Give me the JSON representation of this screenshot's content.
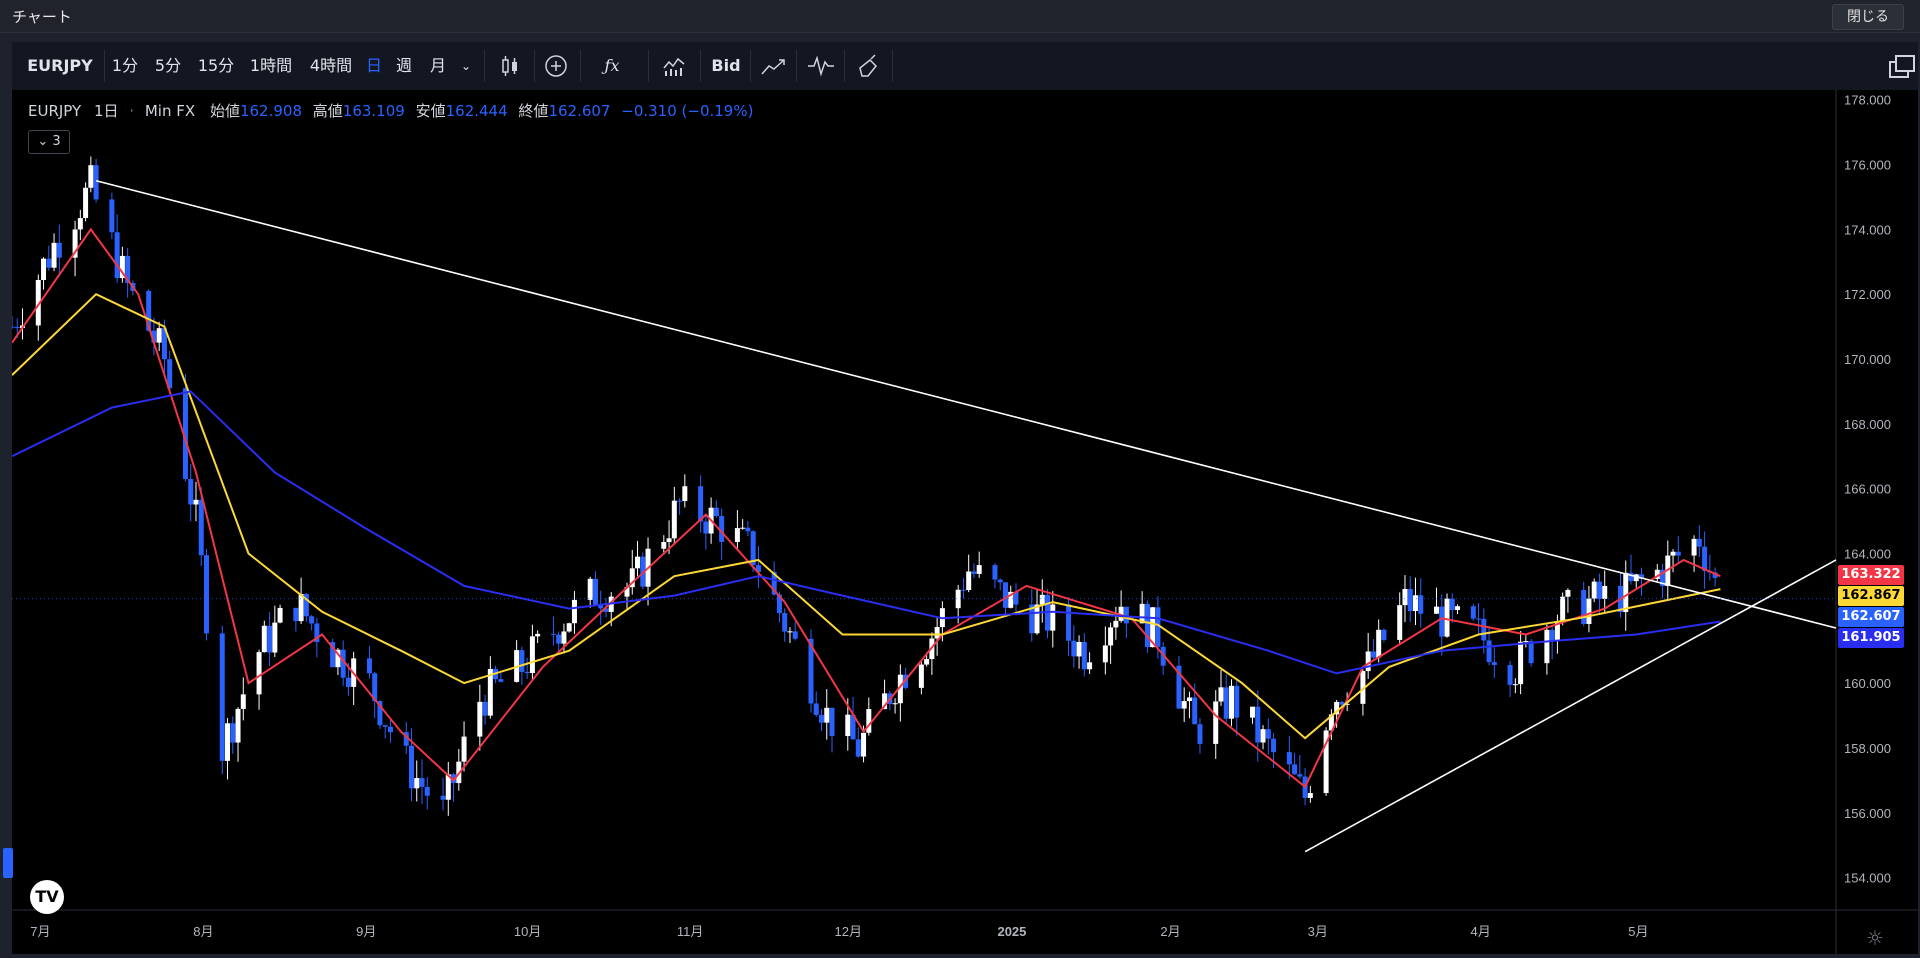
{
  "window": {
    "title": "チャート",
    "close_label": "閉じる"
  },
  "toolbar": {
    "symbol": "EURJPY",
    "intervals": [
      "1分",
      "5分",
      "15分",
      "1時間",
      "4時間",
      "日",
      "週",
      "月"
    ],
    "active_interval": "日",
    "bid_label": "Bid"
  },
  "legend": {
    "symbol": "EURJPY",
    "interval": "1日",
    "source": "Min FX",
    "open_label": "始値",
    "open": "162.908",
    "high_label": "高値",
    "high": "163.109",
    "low_label": "安値",
    "low": "162.444",
    "close_label": "終値",
    "close": "162.607",
    "change": "−0.310 (−0.19%)",
    "indicator_count": "3"
  },
  "colors": {
    "background": "#000000",
    "up_candle": "#ffffff",
    "down_candle": "#2962ff",
    "ma_fast": "#f23645",
    "ma_mid": "#fdd835",
    "ma_slow": "#2a2ef0",
    "trendline": "#ffffff"
  },
  "price_tags": [
    {
      "value": "163.322",
      "bg": "#f23645",
      "fg": "#ffffff"
    },
    {
      "value": "162.867",
      "bg": "#fdd835",
      "fg": "#000000"
    },
    {
      "value": "162.607",
      "bg": "#2962ff",
      "fg": "#ffffff"
    },
    {
      "value": "161.905",
      "bg": "#2a2ef0",
      "fg": "#ffffff"
    }
  ],
  "chart_data": {
    "type": "candlestick",
    "symbol": "EURJPY",
    "ylim": [
      153.0,
      178.3
    ],
    "y_ticks": [
      "154.000",
      "156.000",
      "158.000",
      "160.000",
      "162.000",
      "164.000",
      "166.000",
      "168.000",
      "170.000",
      "172.000",
      "174.000",
      "176.000",
      "178.000"
    ],
    "x_ticks": [
      {
        "label": "7月",
        "date": "2024-07-01"
      },
      {
        "label": "8月",
        "date": "2024-08-01"
      },
      {
        "label": "9月",
        "date": "2024-09-01"
      },
      {
        "label": "10月",
        "date": "2024-10-01"
      },
      {
        "label": "11月",
        "date": "2024-11-01"
      },
      {
        "label": "12月",
        "date": "2024-12-01"
      },
      {
        "label": "2025",
        "date": "2025-01-01"
      },
      {
        "label": "2月",
        "date": "2025-02-01"
      },
      {
        "label": "3月",
        "date": "2025-03-01"
      },
      {
        "label": "4月",
        "date": "2025-04-01"
      },
      {
        "label": "5月",
        "date": "2025-05-01"
      }
    ],
    "x_range": [
      "2024-06-26",
      "2025-06-08"
    ],
    "close_path": [
      [
        "2024-06-26",
        171.0
      ],
      [
        "2024-07-04",
        173.5
      ],
      [
        "2024-07-11",
        175.3
      ],
      [
        "2024-07-18",
        172.2
      ],
      [
        "2024-07-25",
        170.0
      ],
      [
        "2024-07-31",
        165.0
      ],
      [
        "2024-08-05",
        158.0
      ],
      [
        "2024-08-12",
        161.0
      ],
      [
        "2024-08-19",
        162.5
      ],
      [
        "2024-08-26",
        161.0
      ],
      [
        "2024-09-02",
        160.0
      ],
      [
        "2024-09-09",
        157.5
      ],
      [
        "2024-09-16",
        156.0
      ],
      [
        "2024-09-23",
        159.5
      ],
      [
        "2024-10-01",
        160.5
      ],
      [
        "2024-10-08",
        161.8
      ],
      [
        "2024-10-15",
        162.8
      ],
      [
        "2024-10-22",
        163.0
      ],
      [
        "2024-10-31",
        165.5
      ],
      [
        "2024-11-07",
        165.0
      ],
      [
        "2024-11-14",
        164.0
      ],
      [
        "2024-11-21",
        161.5
      ],
      [
        "2024-11-28",
        159.0
      ],
      [
        "2024-12-04",
        158.0
      ],
      [
        "2024-12-11",
        160.0
      ],
      [
        "2024-12-18",
        161.5
      ],
      [
        "2024-12-25",
        163.5
      ],
      [
        "2025-01-02",
        162.5
      ],
      [
        "2025-01-09",
        162.0
      ],
      [
        "2025-01-16",
        161.0
      ],
      [
        "2025-01-23",
        162.5
      ],
      [
        "2025-01-30",
        161.5
      ],
      [
        "2025-02-06",
        158.5
      ],
      [
        "2025-02-13",
        159.5
      ],
      [
        "2025-02-20",
        158.0
      ],
      [
        "2025-02-27",
        156.5
      ],
      [
        "2025-03-04",
        159.5
      ],
      [
        "2025-03-11",
        160.5
      ],
      [
        "2025-03-18",
        162.5
      ],
      [
        "2025-03-25",
        162.0
      ],
      [
        "2025-04-01",
        161.5
      ],
      [
        "2025-04-08",
        160.5
      ],
      [
        "2025-04-15",
        162.0
      ],
      [
        "2025-04-22",
        162.5
      ],
      [
        "2025-04-29",
        162.8
      ],
      [
        "2025-05-06",
        163.5
      ],
      [
        "2025-05-13",
        164.5
      ],
      [
        "2025-05-17",
        162.6
      ]
    ],
    "moving_averages": [
      {
        "color": "#f23645",
        "period": "fast",
        "points": [
          [
            "2024-06-26",
            170.5
          ],
          [
            "2024-07-11",
            174.0
          ],
          [
            "2024-07-20",
            172.0
          ],
          [
            "2024-07-31",
            166.5
          ],
          [
            "2024-08-10",
            160.0
          ],
          [
            "2024-08-24",
            161.5
          ],
          [
            "2024-09-08",
            158.5
          ],
          [
            "2024-09-18",
            157.0
          ],
          [
            "2024-10-05",
            160.5
          ],
          [
            "2024-10-20",
            162.8
          ],
          [
            "2024-11-05",
            165.2
          ],
          [
            "2024-11-20",
            162.5
          ],
          [
            "2024-12-05",
            158.5
          ],
          [
            "2024-12-20",
            161.5
          ],
          [
            "2025-01-05",
            163.0
          ],
          [
            "2025-01-25",
            162.0
          ],
          [
            "2025-02-10",
            159.0
          ],
          [
            "2025-02-27",
            156.8
          ],
          [
            "2025-03-10",
            160.5
          ],
          [
            "2025-03-25",
            162.0
          ],
          [
            "2025-04-10",
            161.5
          ],
          [
            "2025-04-25",
            162.3
          ],
          [
            "2025-05-10",
            163.8
          ],
          [
            "2025-05-17",
            163.3
          ]
        ]
      },
      {
        "color": "#fdd835",
        "period": "mid",
        "points": [
          [
            "2024-06-26",
            169.5
          ],
          [
            "2024-07-12",
            172.0
          ],
          [
            "2024-07-25",
            171.0
          ],
          [
            "2024-08-10",
            164.0
          ],
          [
            "2024-08-24",
            162.2
          ],
          [
            "2024-09-08",
            161.0
          ],
          [
            "2024-09-20",
            160.0
          ],
          [
            "2024-10-10",
            161.0
          ],
          [
            "2024-10-30",
            163.3
          ],
          [
            "2024-11-15",
            163.8
          ],
          [
            "2024-12-01",
            161.5
          ],
          [
            "2024-12-20",
            161.5
          ],
          [
            "2025-01-10",
            162.5
          ],
          [
            "2025-01-30",
            161.8
          ],
          [
            "2025-02-15",
            160.0
          ],
          [
            "2025-02-27",
            158.3
          ],
          [
            "2025-03-15",
            160.5
          ],
          [
            "2025-04-01",
            161.5
          ],
          [
            "2025-04-20",
            162.0
          ],
          [
            "2025-05-05",
            162.5
          ],
          [
            "2025-05-17",
            162.9
          ]
        ]
      },
      {
        "color": "#2a2ef0",
        "period": "slow",
        "points": [
          [
            "2024-06-26",
            167.0
          ],
          [
            "2024-07-15",
            168.5
          ],
          [
            "2024-07-30",
            169.0
          ],
          [
            "2024-08-15",
            166.5
          ],
          [
            "2024-09-01",
            164.8
          ],
          [
            "2024-09-20",
            163.0
          ],
          [
            "2024-10-10",
            162.3
          ],
          [
            "2024-10-30",
            162.7
          ],
          [
            "2024-11-15",
            163.3
          ],
          [
            "2024-12-01",
            162.7
          ],
          [
            "2024-12-20",
            162.0
          ],
          [
            "2025-01-10",
            162.2
          ],
          [
            "2025-01-30",
            162.0
          ],
          [
            "2025-02-20",
            161.0
          ],
          [
            "2025-03-05",
            160.3
          ],
          [
            "2025-03-25",
            161.0
          ],
          [
            "2025-04-15",
            161.3
          ],
          [
            "2025-05-01",
            161.5
          ],
          [
            "2025-05-17",
            161.9
          ]
        ]
      }
    ],
    "trendlines": [
      {
        "from": [
          "2024-07-12",
          175.5
        ],
        "to": [
          "2025-06-08",
          161.7
        ]
      },
      {
        "from": [
          "2025-02-27",
          154.8
        ],
        "to": [
          "2025-06-08",
          163.8
        ]
      }
    ],
    "last_price": 162.607
  }
}
